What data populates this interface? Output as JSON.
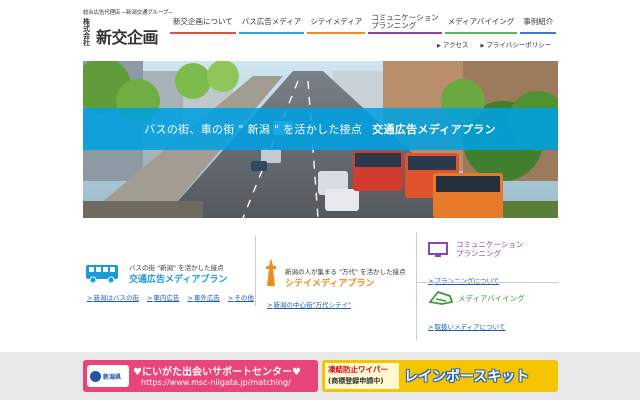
{
  "logo": {
    "sub": "総合広告代理店 −新潟交通グループ−",
    "kabu": "株式会社",
    "name": "新交企画"
  },
  "nav": {
    "items": [
      {
        "label": "新交企画について"
      },
      {
        "label": "バス広告メディア"
      },
      {
        "label": "シテイメディア"
      },
      {
        "label": "コミュニケーション\nプランニング"
      },
      {
        "label": "メディアバイイング"
      },
      {
        "label": "事例紹介"
      }
    ]
  },
  "subnav": {
    "access": "アクセス",
    "privacy": "プライバシーポリシー"
  },
  "hero": {
    "caption": "バスの街、車の街 \" 新潟 \" を活かした接点",
    "caption_strong": "交通広告メディアプラン"
  },
  "panels": {
    "bus": {
      "small": "バスの街 \"新潟\" を活かした接点",
      "title": "交通広告メディアプラン",
      "links": [
        "新潟はバスの街",
        "車内広告",
        "車外広告",
        "その他"
      ]
    },
    "city": {
      "small": "新潟の人が集まる \"万代\" を活かした接点",
      "title": "シテイメディアプラン",
      "link": "新潟の中心街\"万代シテイ\""
    },
    "comm": {
      "title_line1": "コミュニケーション",
      "title_line2": "プランニング",
      "link": "プランニングについて"
    },
    "buying": {
      "title": "メディアバイイング",
      "link": "取扱いメディアについて"
    }
  },
  "banners": {
    "b1": {
      "pref": "新潟県",
      "title": "♥にいがた出会いサポートセンター♥",
      "url": "https://www.msc-niigata.jp/matching/"
    },
    "b2": {
      "l1": "凍結防止ワイパー",
      "l2": "(商標登録申請中)",
      "main": "レインボースキット"
    }
  },
  "colors": {
    "accent_blue": "#00a0e1",
    "brand_pink": "#e9457a",
    "brand_yellow": "#f5c400"
  }
}
